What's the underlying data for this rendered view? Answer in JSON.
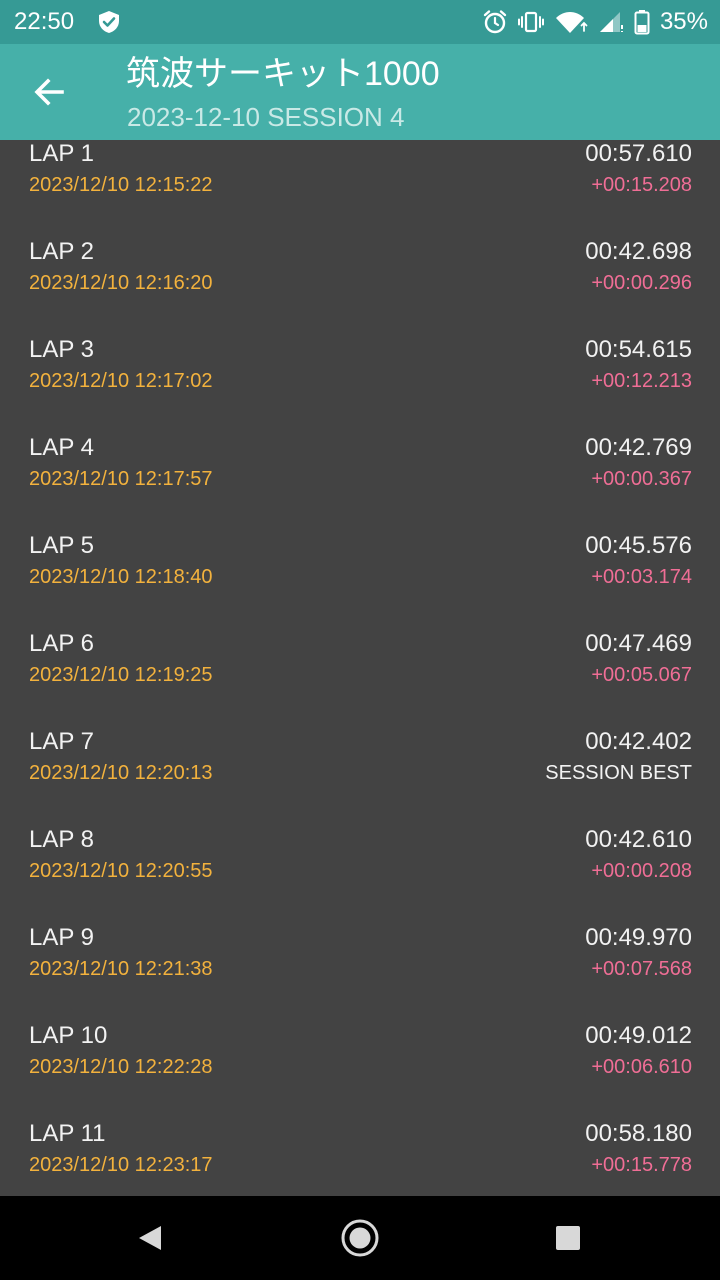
{
  "status_bar": {
    "time": "22:50",
    "battery_percent": "35%",
    "icons": [
      "shield-icon",
      "alarm-icon",
      "vibrate-icon",
      "wifi-icon",
      "cell-signal-icon",
      "battery-icon"
    ],
    "color": "#369A95"
  },
  "app_bar": {
    "title": "筑波サーキット1000",
    "subtitle": "2023-12-10 SESSION 4",
    "back_icon": "arrow-back-icon",
    "color": "#46B0A9"
  },
  "laps": [
    {
      "name": "LAP 1",
      "timestamp": "2023/12/10 12:15:22",
      "time": "00:57.610",
      "diff": "+00:15.208",
      "best": false
    },
    {
      "name": "LAP 2",
      "timestamp": "2023/12/10 12:16:20",
      "time": "00:42.698",
      "diff": "+00:00.296",
      "best": false
    },
    {
      "name": "LAP 3",
      "timestamp": "2023/12/10 12:17:02",
      "time": "00:54.615",
      "diff": "+00:12.213",
      "best": false
    },
    {
      "name": "LAP 4",
      "timestamp": "2023/12/10 12:17:57",
      "time": "00:42.769",
      "diff": "+00:00.367",
      "best": false
    },
    {
      "name": "LAP 5",
      "timestamp": "2023/12/10 12:18:40",
      "time": "00:45.576",
      "diff": "+00:03.174",
      "best": false
    },
    {
      "name": "LAP 6",
      "timestamp": "2023/12/10 12:19:25",
      "time": "00:47.469",
      "diff": "+00:05.067",
      "best": false
    },
    {
      "name": "LAP 7",
      "timestamp": "2023/12/10 12:20:13",
      "time": "00:42.402",
      "diff": "SESSION BEST",
      "best": true
    },
    {
      "name": "LAP 8",
      "timestamp": "2023/12/10 12:20:55",
      "time": "00:42.610",
      "diff": "+00:00.208",
      "best": false
    },
    {
      "name": "LAP 9",
      "timestamp": "2023/12/10 12:21:38",
      "time": "00:49.970",
      "diff": "+00:07.568",
      "best": false
    },
    {
      "name": "LAP 10",
      "timestamp": "2023/12/10 12:22:28",
      "time": "00:49.012",
      "diff": "+00:06.610",
      "best": false
    },
    {
      "name": "LAP 11",
      "timestamp": "2023/12/10 12:23:17",
      "time": "00:58.180",
      "diff": "+00:15.778",
      "best": false
    }
  ],
  "colors": {
    "background": "#434343",
    "timestamp": "#F3B23D",
    "diff": "#F06E96",
    "text": "#F2F2F2"
  },
  "nav_bar": {
    "icons": [
      "back-triangle-icon",
      "home-circle-icon",
      "recents-square-icon"
    ]
  }
}
